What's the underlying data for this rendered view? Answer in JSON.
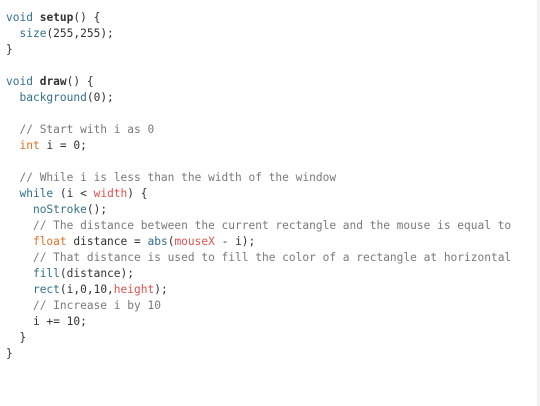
{
  "code_lines": [
    [
      [
        "kw",
        "void"
      ],
      [
        "tx",
        " "
      ],
      [
        "fn",
        "setup"
      ],
      [
        "tx",
        "() {"
      ]
    ],
    [
      [
        "tx",
        "  "
      ],
      [
        "bi",
        "size"
      ],
      [
        "tx",
        "(255,255);"
      ]
    ],
    [
      [
        "tx",
        "}"
      ]
    ],
    [],
    [
      [
        "kw",
        "void"
      ],
      [
        "tx",
        " "
      ],
      [
        "fn",
        "draw"
      ],
      [
        "tx",
        "() {"
      ]
    ],
    [
      [
        "tx",
        "  "
      ],
      [
        "bi",
        "background"
      ],
      [
        "tx",
        "(0);"
      ]
    ],
    [],
    [
      [
        "tx",
        "  "
      ],
      [
        "cm",
        "// Start with i as 0"
      ]
    ],
    [
      [
        "tx",
        "  "
      ],
      [
        "ty",
        "int"
      ],
      [
        "tx",
        " i = 0;"
      ]
    ],
    [],
    [
      [
        "tx",
        "  "
      ],
      [
        "cm",
        "// While i is less than the width of the window"
      ]
    ],
    [
      [
        "tx",
        "  "
      ],
      [
        "kw",
        "while"
      ],
      [
        "tx",
        " (i < "
      ],
      [
        "var",
        "width"
      ],
      [
        "tx",
        ") {"
      ]
    ],
    [
      [
        "tx",
        "    "
      ],
      [
        "bi",
        "noStroke"
      ],
      [
        "tx",
        "();"
      ]
    ],
    [
      [
        "tx",
        "    "
      ],
      [
        "cm",
        "// The distance between the current rectangle and the mouse is equal to"
      ]
    ],
    [
      [
        "tx",
        "    "
      ],
      [
        "ty",
        "float"
      ],
      [
        "tx",
        " distance = "
      ],
      [
        "bi",
        "abs"
      ],
      [
        "tx",
        "("
      ],
      [
        "var",
        "mouseX"
      ],
      [
        "tx",
        " - i);"
      ]
    ],
    [
      [
        "tx",
        "    "
      ],
      [
        "cm",
        "// That distance is used to fill the color of a rectangle at horizontal"
      ]
    ],
    [
      [
        "tx",
        "    "
      ],
      [
        "bi",
        "fill"
      ],
      [
        "tx",
        "(distance);"
      ]
    ],
    [
      [
        "tx",
        "    "
      ],
      [
        "bi",
        "rect"
      ],
      [
        "tx",
        "(i,0,10,"
      ],
      [
        "var",
        "height"
      ],
      [
        "tx",
        ");"
      ]
    ],
    [
      [
        "tx",
        "    "
      ],
      [
        "cm",
        "// Increase i by 10"
      ]
    ],
    [
      [
        "tx",
        "    i += 10;"
      ]
    ],
    [
      [
        "tx",
        "  }"
      ]
    ],
    [
      [
        "tx",
        "}"
      ]
    ]
  ]
}
